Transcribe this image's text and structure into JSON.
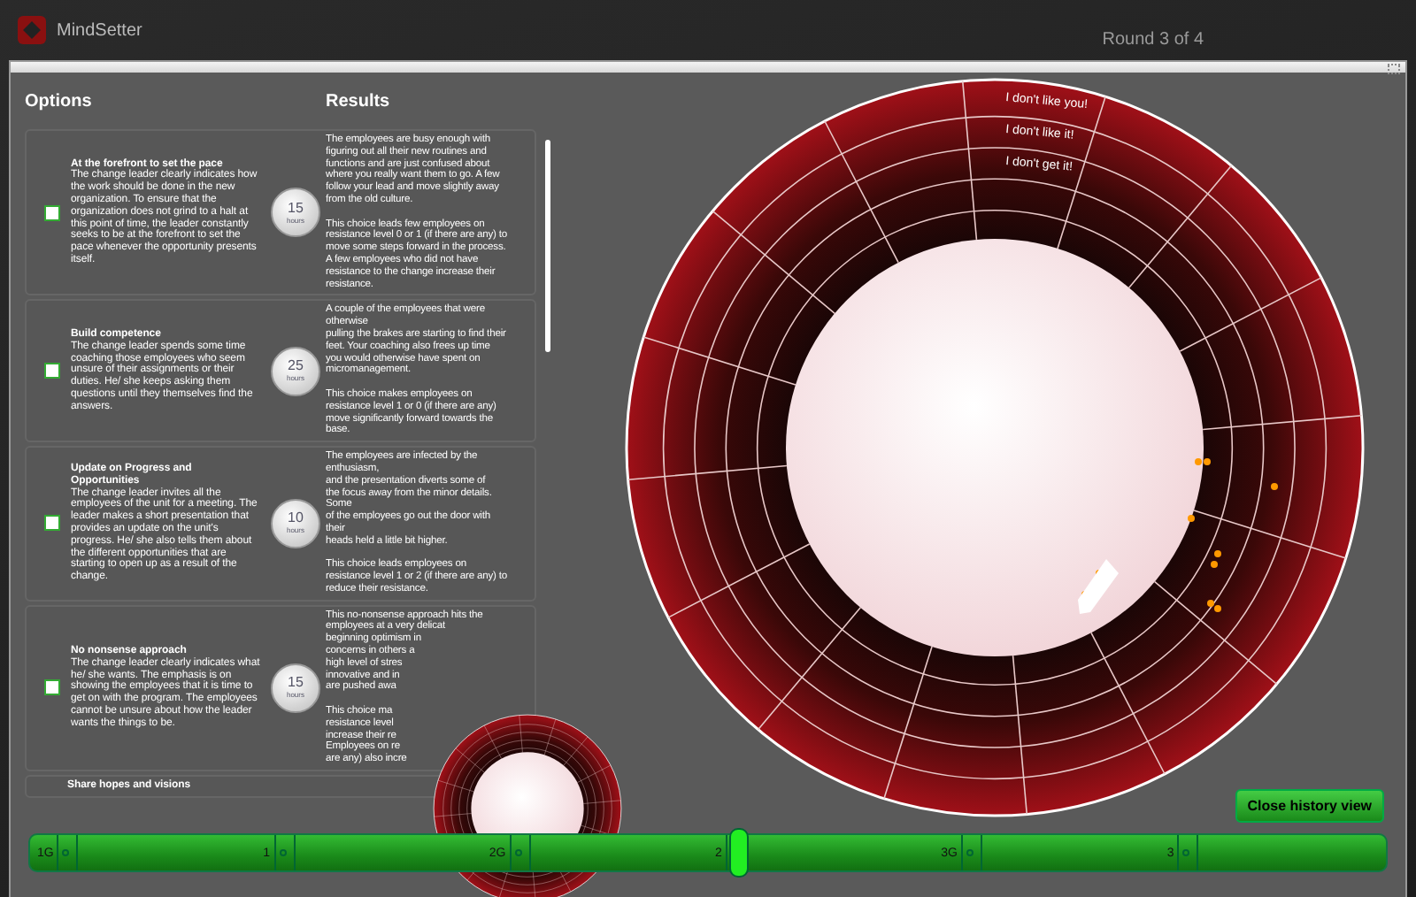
{
  "app": {
    "name": "MindSetter",
    "round": "Round 3 of  4"
  },
  "options_heading": "Options",
  "results_heading": "Results",
  "options": [
    {
      "title": "At the forefront to set the pace",
      "description": "The change leader clearly indicates how the work should be done in the new organization. To ensure that the organization does not grind to a halt at this point of time, the leader constantly seeks to be at the forefront to set the pace whenever the opportunity presents itself.",
      "hours": "15",
      "unit": "hours",
      "result": "The employees are busy enough with\nfiguring out all their new routines and\nfunctions and are just confused about\nwhere you really want them to go. A few\nfollow your lead and move slightly away\nfrom the old culture.\n\nThis choice leads few employees on\nresistance level 0 or 1 (if there are any) to\nmove some steps forward in the process.\nA few employees who did not have\nresistance to the change increase their\nresistance.",
      "checked": false
    },
    {
      "title": "Build competence",
      "description": "The change leader spends some time coaching those employees who seem unsure of their assignments or their duties. He/ she keeps asking them questions until they themselves find the answers.",
      "hours": "25",
      "unit": "hours",
      "result": "A couple of the employees that were\notherwise\npulling the brakes are starting to find their\nfeet. Your coaching also frees up time\nyou would otherwise have spent on\nmicromanagement.\n\nThis choice makes employees on\nresistance level 1 or 0 (if there are any)\nmove significantly forward towards the\nbase.",
      "checked": false
    },
    {
      "title": "Update on Progress and Opportunities",
      "description": "The change leader invites all the employees of the unit for a meeting. The leader makes a short presentation that provides an update on the unit's progress. He/ she also tells them about the different opportunities that are starting to open up as a result of the change.",
      "hours": "10",
      "unit": "hours",
      "result": "The employees are infected by the\nenthusiasm,\nand the presentation diverts some of\nthe focus away from the minor details.\nSome\nof the employees go out the door with\ntheir\nheads held a little bit higher.\n\nThis choice leads employees on\nresistance level 1 or 2 (if there are any) to\nreduce their resistance.",
      "checked": false
    },
    {
      "title": "No nonsense approach",
      "description": "The change leader clearly indicates what he/ she wants. The emphasis is on showing the employees that it is time to get on with the program. The employees cannot be unsure about how the leader wants the things to be.",
      "hours": "15",
      "unit": "hours",
      "result": "This no-nonsense approach hits the\nemployees at a very delicat\nbeginning optimism in\nconcerns in others a\nhigh level of stres\ninnovative and in\nare pushed awa\n\nThis choice ma\nresistance level\nincrease their re\nEmployees on re\nare any) also incre",
      "checked": false
    },
    {
      "title": "Share hopes and visions"
    }
  ],
  "circle": {
    "ring_labels": [
      "I don't like you!",
      "I don't like it!",
      "I don't get it!"
    ]
  },
  "history_button": "Close history view",
  "timeline": {
    "markers": [
      {
        "label": "1G"
      },
      {
        "label": "1"
      },
      {
        "label": "2G"
      },
      {
        "label": "2"
      },
      {
        "label": "3G"
      },
      {
        "label": "3"
      }
    ],
    "level": 0.5
  }
}
